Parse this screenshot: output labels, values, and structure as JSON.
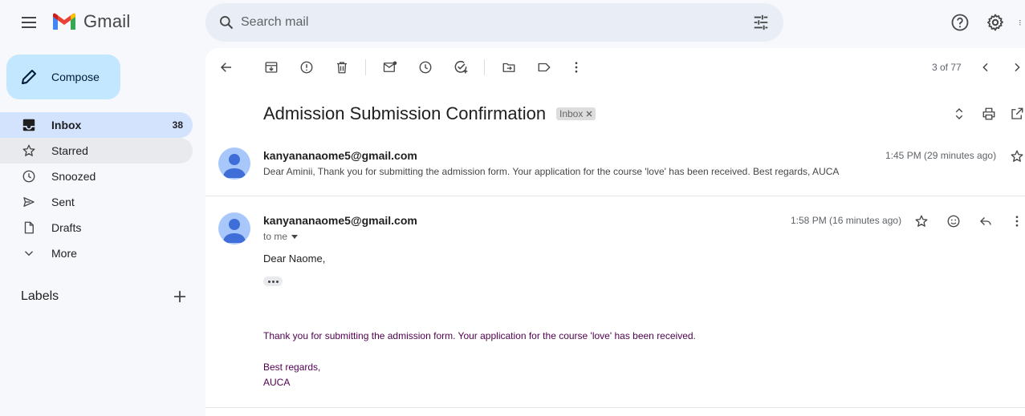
{
  "app": {
    "name": "Gmail"
  },
  "search": {
    "placeholder": "Search mail"
  },
  "sidebar": {
    "compose_label": "Compose",
    "items": [
      {
        "label": "Inbox",
        "count": "38",
        "icon": "inbox-icon"
      },
      {
        "label": "Starred",
        "count": "",
        "icon": "star-icon"
      },
      {
        "label": "Snoozed",
        "count": "",
        "icon": "clock-icon"
      },
      {
        "label": "Sent",
        "count": "",
        "icon": "send-icon"
      },
      {
        "label": "Drafts",
        "count": "",
        "icon": "draft-icon"
      },
      {
        "label": "More",
        "count": "",
        "icon": "chevron-down-icon"
      }
    ],
    "labels_heading": "Labels"
  },
  "toolbar": {
    "pager": "3 of 77"
  },
  "thread": {
    "subject": "Admission Submission Confirmation",
    "chip": "Inbox",
    "messages": [
      {
        "sender": "kanyananaome5@gmail.com",
        "time": "1:45 PM (29 minutes ago)",
        "snippet": "Dear Aminii, Thank you for submitting the admission form. Your application for the course 'love' has been received. Best regards, AUCA"
      },
      {
        "sender": "kanyananaome5@gmail.com",
        "time": "1:58 PM (16 minutes ago)",
        "to": "to me",
        "greeting": "Dear Naome,",
        "body": "Thank you for submitting the admission form. Your application for the course 'love' has been received.",
        "signoff": "Best regards,",
        "signature": "AUCA"
      }
    ]
  },
  "colors": {
    "accent": "#0b57d0",
    "compose_bg": "#c2e7ff",
    "active_nav": "#d3e3fd",
    "quoted_text": "#500050"
  }
}
